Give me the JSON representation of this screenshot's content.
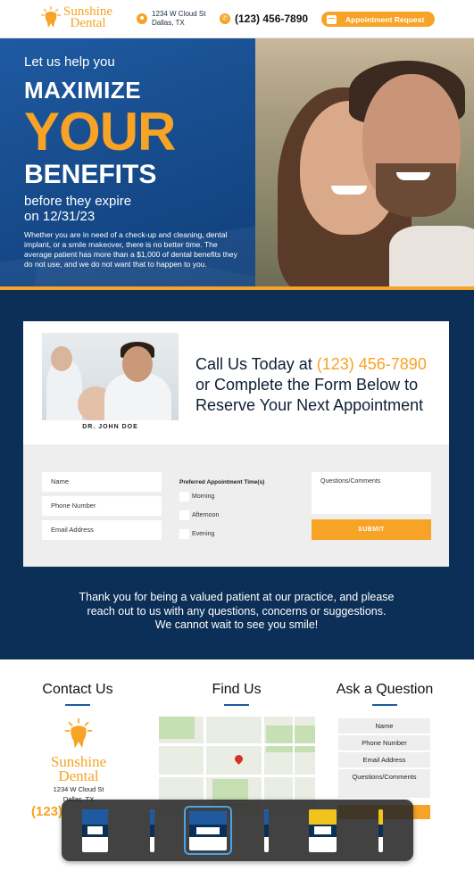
{
  "header": {
    "brand_line1": "Sunshine",
    "brand_line2": "Dental",
    "address_line1": "1234 W Cloud St",
    "address_line2": "Dallas, TX",
    "phone": "(123) 456-7890",
    "appointment_button": "Appointment Request",
    "icons": {
      "location": "location-pin-icon",
      "phone": "phone-icon",
      "calendar": "calendar-icon",
      "logo": "tooth-sun-icon"
    }
  },
  "hero": {
    "line1": "Let us help you",
    "line2": "MAXIMIZE",
    "line3": "YOUR",
    "line4": "BENEFITS",
    "line5": "before they expire",
    "line6": "on 12/31/23",
    "paragraph": "Whether you are in need of a check-up and cleaning, dental implant, or a smile makeover, there is no better time. The average patient has more than a $1,000 of dental benefits they do not use, and we do not want that to happen to you."
  },
  "call_card": {
    "photo_caption": "DR. JOHN DOE",
    "call_prefix": "Call Us Today at ",
    "call_phone": "(123) 456-7890",
    "line2": "or Complete the Form Below to",
    "line3": "Reserve Your Next Appointment"
  },
  "form": {
    "name_placeholder": "Name",
    "phone_placeholder": "Phone Number",
    "email_placeholder": "Email Address",
    "pref_title": "Preferred Appointment Time(s)",
    "times": [
      "Morning",
      "Afternoon",
      "Evening"
    ],
    "comments_placeholder": "Questions/Comments",
    "submit_label": "SUBMIT"
  },
  "thanks": {
    "line1": "Thank you for being a valued patient at our practice, and please",
    "line2": "reach out to us with any questions, concerns or suggestions.",
    "line3": "We cannot wait to see you smile!"
  },
  "footer": {
    "contact_title": "Contact Us",
    "find_title": "Find Us",
    "ask_title": "Ask a Question",
    "brand_line1": "Sunshine",
    "brand_line2": "Dental",
    "address_line1": "1234 W Cloud St",
    "address_line2": "Dallas, TX",
    "phone_partial": "(123)",
    "ask_fields": [
      "Name",
      "Phone Number",
      "Email Address",
      "Questions/Comments"
    ]
  },
  "colors": {
    "orange": "#f7a325",
    "blue": "#1f5aa1",
    "navy": "#0c2f57"
  }
}
